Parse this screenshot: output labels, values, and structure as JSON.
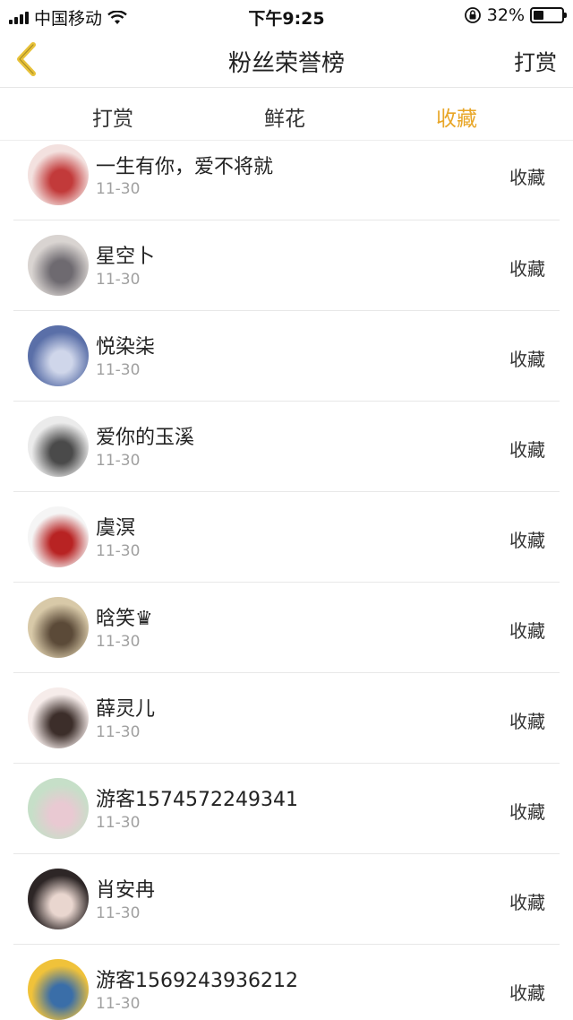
{
  "status_bar": {
    "carrier": "中国移动",
    "time": "下午9:25",
    "battery_text": "32%",
    "battery_level": 0.32
  },
  "nav": {
    "title": "粉丝荣誉榜",
    "right_label": "打赏",
    "accent_color": "#e8c23a"
  },
  "tabs": [
    {
      "label": "打赏",
      "active": false
    },
    {
      "label": "鲜花",
      "active": false
    },
    {
      "label": "收藏",
      "active": true
    }
  ],
  "active_tab_color": "#e8a627",
  "rows": [
    {
      "name": "一生有你，爱不将就",
      "date": "11-30",
      "action": "收藏",
      "avatar_colors": [
        "#f3e1df",
        "#c23a3a"
      ]
    },
    {
      "name": "星空卜",
      "date": "11-30",
      "action": "收藏",
      "avatar_colors": [
        "#d9d4d1",
        "#6e6a70"
      ]
    },
    {
      "name": "悦染柒",
      "date": "11-30",
      "action": "收藏",
      "avatar_colors": [
        "#5a6fa8",
        "#cfd6ea"
      ]
    },
    {
      "name": "爱你的玉溪",
      "date": "11-30",
      "action": "收藏",
      "avatar_colors": [
        "#ebebeb",
        "#4a4a4a"
      ]
    },
    {
      "name": "虞溟",
      "date": "11-30",
      "action": "收藏",
      "avatar_colors": [
        "#f5f5f5",
        "#b82323"
      ]
    },
    {
      "name": "晗笑♛",
      "date": "11-30",
      "action": "收藏",
      "avatar_colors": [
        "#d8c9a8",
        "#5b4a38"
      ]
    },
    {
      "name": "薛灵儿",
      "date": "11-30",
      "action": "收藏",
      "avatar_colors": [
        "#f6ecea",
        "#3c2e2a"
      ]
    },
    {
      "name": "游客1574572249341",
      "date": "11-30",
      "action": "收藏",
      "avatar_colors": [
        "#c6dfc8",
        "#e9c9d2"
      ]
    },
    {
      "name": "肖安冉",
      "date": "11-30",
      "action": "收藏",
      "avatar_colors": [
        "#2d2626",
        "#e9d6cf"
      ]
    },
    {
      "name": "游客1569243936212",
      "date": "11-30",
      "action": "收藏",
      "avatar_colors": [
        "#f0c23a",
        "#3a6ea8"
      ]
    }
  ]
}
